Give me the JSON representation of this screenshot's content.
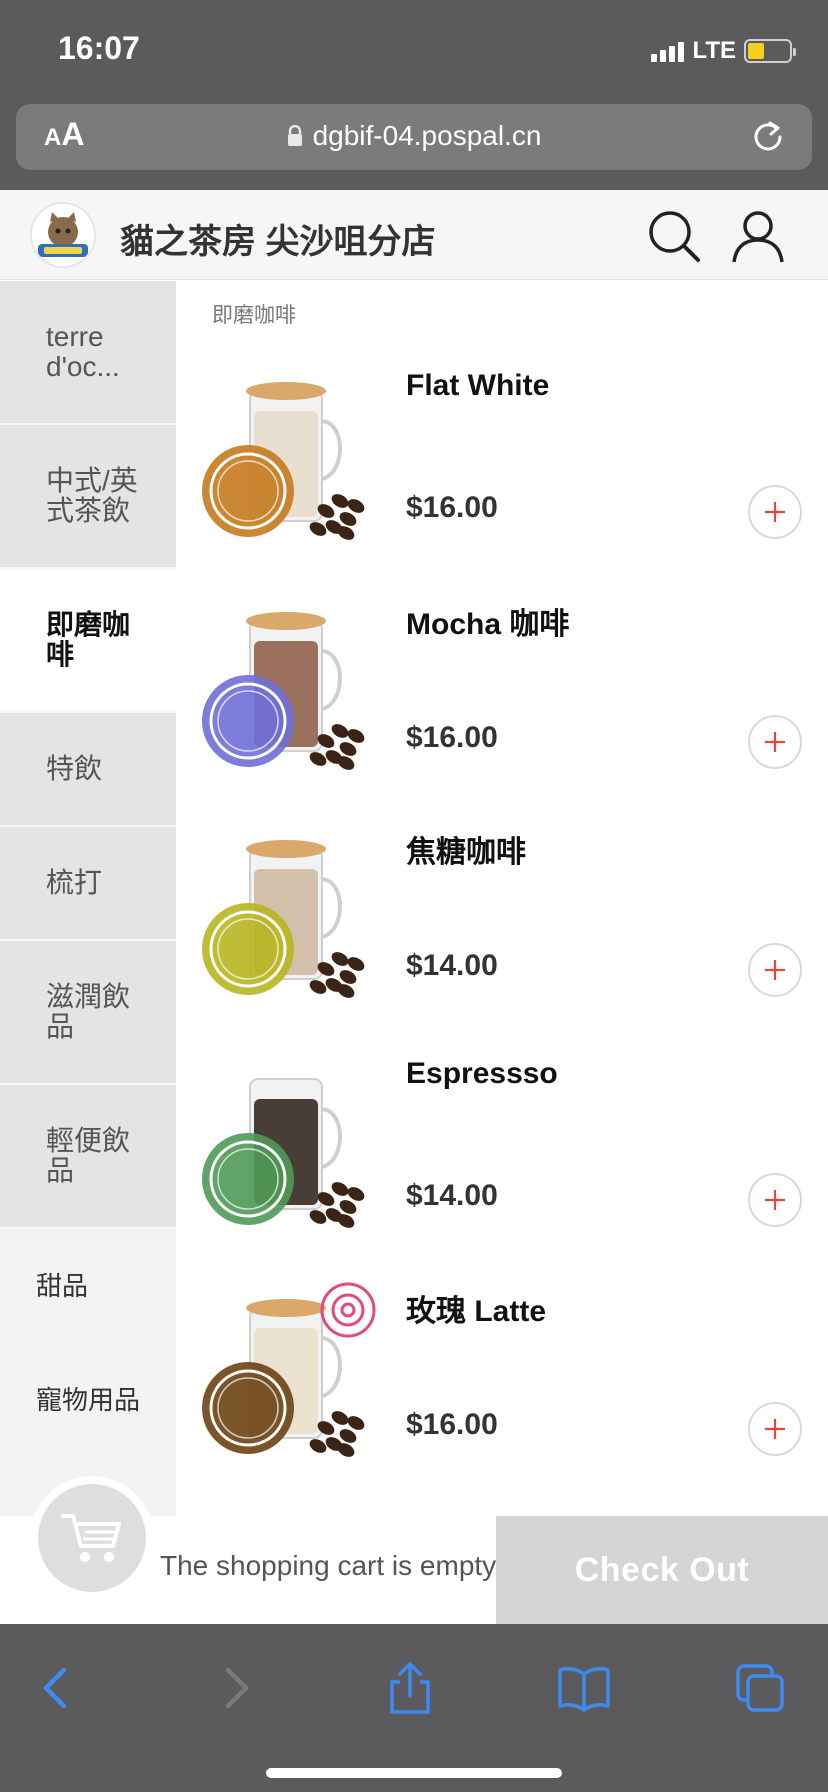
{
  "status_bar": {
    "time": "16:07",
    "network": "LTE",
    "battery_level": 0.4
  },
  "browser": {
    "text_size_small": "A",
    "text_size_big": "A",
    "url": "dgbif-04.pospal.cn"
  },
  "store": {
    "name": "貓之茶房 尖沙咀分店"
  },
  "sidebar": {
    "categories": [
      {
        "label": "terre d'oc..."
      },
      {
        "label": "中式/英式茶飲"
      },
      {
        "label": "即磨咖啡"
      },
      {
        "label": "特飲"
      },
      {
        "label": "梳打"
      },
      {
        "label": "滋潤飲品"
      },
      {
        "label": "輕便飲品"
      },
      {
        "label": "甜品"
      },
      {
        "label": "寵物用品"
      }
    ],
    "active_index": 2
  },
  "section": {
    "title": "即磨咖啡"
  },
  "products": [
    {
      "name": "Flat White",
      "price": "$16.00",
      "badge_color": "#c57a1e",
      "drink_color": "#e6dccb"
    },
    {
      "name": "Mocha 咖啡",
      "price": "$16.00",
      "badge_color": "#6f6fd8",
      "drink_color": "#8c5a44"
    },
    {
      "name": "焦糖咖啡",
      "price": "$14.00",
      "badge_color": "#b8b51f",
      "drink_color": "#cdb79d"
    },
    {
      "name": "Espressso",
      "price": "$14.00",
      "badge_color": "#4f9a56",
      "drink_color": "#2b1d17"
    },
    {
      "name": "玫瑰 Latte",
      "price": "$16.00",
      "badge_color": "#6b4212",
      "drink_color": "#e9dfc8"
    }
  ],
  "cart": {
    "empty_text": "The shopping cart is empty",
    "checkout_label": "Check Out"
  },
  "colors": {
    "accent_red": "#e8453c",
    "browser_chrome": "#5b5b5d",
    "toolbar_blue": "#3d8bf2"
  }
}
